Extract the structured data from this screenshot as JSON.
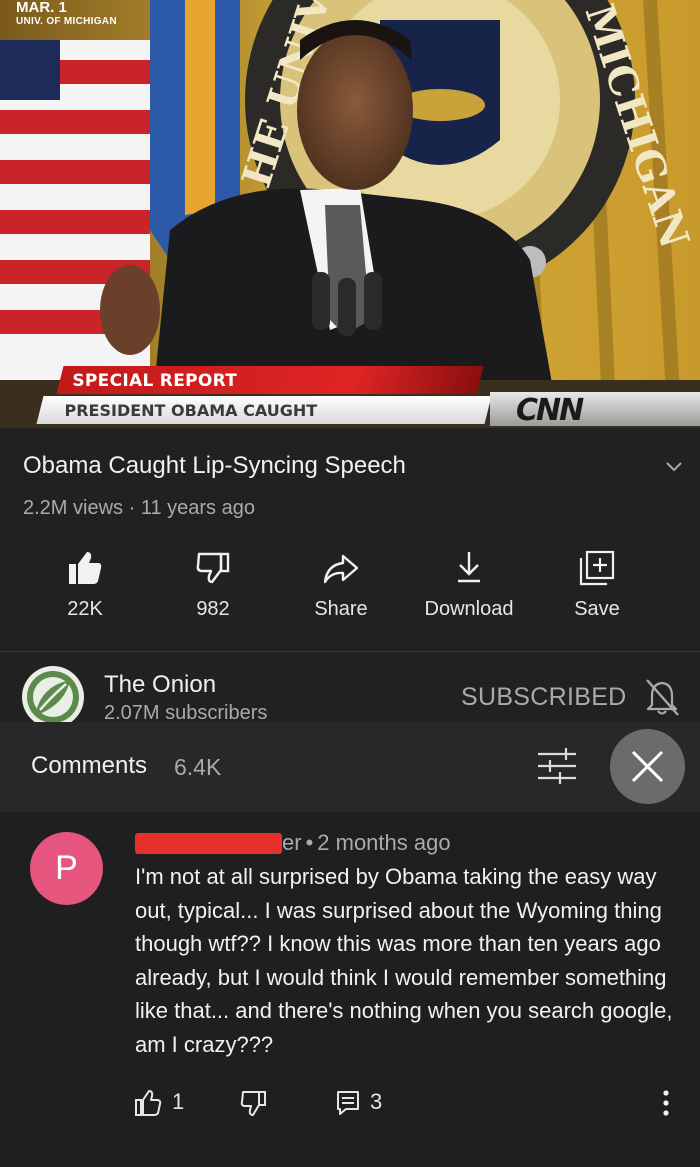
{
  "video": {
    "dateline_date": "MAR. 1",
    "dateline_place": "UNIV. OF MICHIGAN",
    "lower_third_top": "SPECIAL REPORT",
    "lower_third_main": "PRESIDENT OBAMA CAUGHT",
    "network_bug": "CNN",
    "seal_text_left": "HE UNIV",
    "seal_text_right": "MICHIGAN"
  },
  "video_info": {
    "title": "Obama Caught Lip-Syncing Speech",
    "views": "2.2M views",
    "separator": " · ",
    "age": "11 years ago"
  },
  "actions": [
    {
      "label": "22K",
      "icon": "thumbs-up-icon"
    },
    {
      "label": "982",
      "icon": "thumbs-down-icon"
    },
    {
      "label": "Share",
      "icon": "share-icon"
    },
    {
      "label": "Download",
      "icon": "download-icon"
    },
    {
      "label": "Save",
      "icon": "save-playlist-icon"
    }
  ],
  "channel": {
    "name": "The Onion",
    "subscribers": "2.07M subscribers",
    "subscribe_state": "SUBSCRIBED",
    "bell_icon": "bell-off-icon"
  },
  "comments": {
    "label": "Comments",
    "count": "6.4K",
    "filter_icon": "sort-filter-icon",
    "close_icon": "close-icon",
    "items": [
      {
        "avatar_letter": "P",
        "avatar_color": "#e6557e",
        "author_visible": "er",
        "dot": "•",
        "age": "2 months ago",
        "text": "I'm not at all surprised by Obama taking the easy way out, typical...  I was surprised about the Wyoming thing though wtf?? I know this was more than ten years ago already, but I would think I would remember something like that... and there's nothing when you search google, am I crazy???",
        "likes": "1",
        "replies": "3"
      }
    ]
  },
  "colors": {
    "background": "#212121",
    "sheet_header": "#282828",
    "secondary_text": "#aaaaaa",
    "redaction": "#e4312b"
  }
}
